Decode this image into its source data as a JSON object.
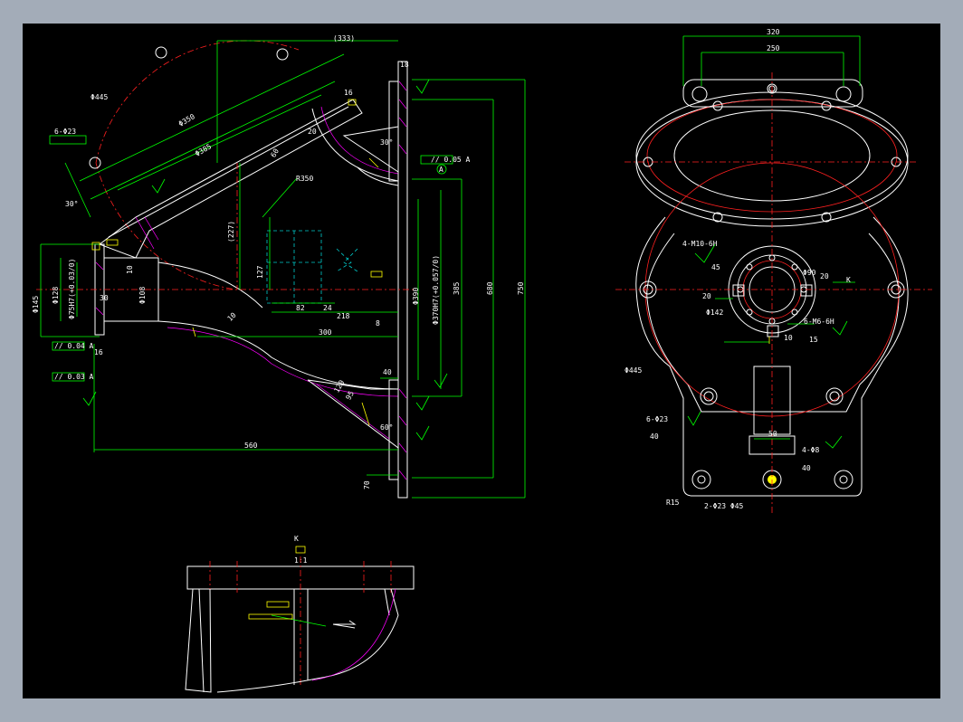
{
  "front_view": {
    "dims": {
      "d333": "(333)",
      "d18": "18",
      "d750": "750",
      "d680": "680",
      "d385": "385",
      "d370": "Φ370H7(+0.057/0)",
      "d390": "Φ390",
      "d560": "560",
      "d300": "300",
      "d218": "218",
      "d8": "8",
      "d82": "82",
      "d24": "24",
      "d127": "127",
      "d227": "(227)",
      "d40": "40",
      "d70": "70",
      "d16": "16",
      "d30a": "30",
      "d10a": "10",
      "d10b": "10",
      "d30angle": "30°",
      "d30angle2": "30°",
      "d60angle": "60°",
      "d445": "Φ445",
      "d385b": "Φ385",
      "d350": "Φ350",
      "dR350": "R350",
      "d108": "Φ108",
      "d128": "Φ128",
      "d75": "Φ75H7(+0.03/0)",
      "d145": "Φ145",
      "d6x23": "6-Φ23",
      "d16b": "16",
      "d20": "20",
      "d60": "60",
      "d95": "95",
      "d120": "120"
    },
    "tolerances": {
      "t1": "// 0.05 A",
      "t2": "// 0.04 A",
      "t3": "// 0.03 A"
    },
    "datum": "A"
  },
  "side_view": {
    "dims": {
      "d320": "320",
      "d250": "250",
      "d90": "Φ90",
      "d142": "Φ142",
      "d20a": "20",
      "d20b": "20",
      "d45": "45",
      "d15": "15",
      "d10": "10",
      "d50": "50",
      "d40": "40",
      "d40b": "40",
      "d445": "Φ445",
      "dR15": "R15",
      "dK": "K"
    },
    "notes": {
      "n1": "4-M10-6H",
      "n2": "6-M6-6H",
      "n3": "6-Φ23",
      "n4": "4-Φ8",
      "n5": "2-Φ23 Φ45"
    }
  },
  "detail_view": {
    "title": "K",
    "scale": "1:1"
  }
}
